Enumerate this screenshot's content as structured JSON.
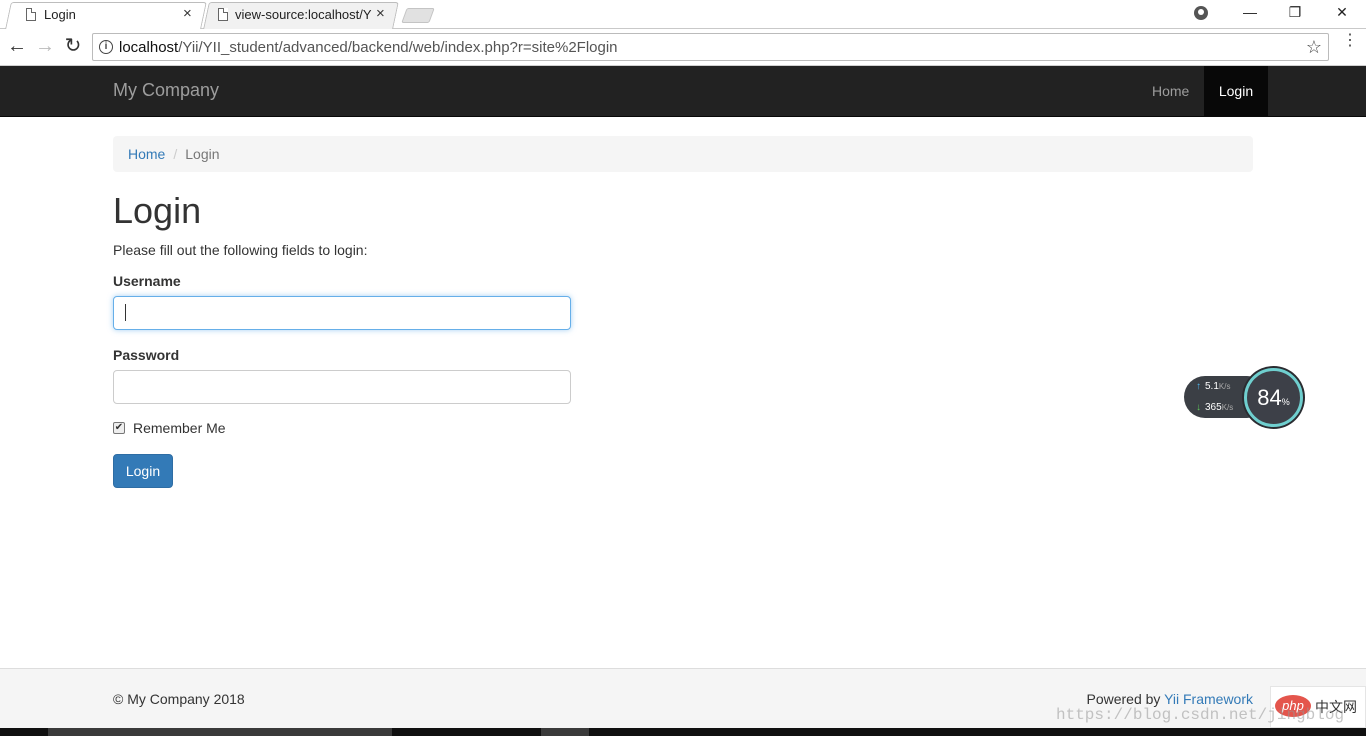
{
  "browser": {
    "tabs": [
      {
        "title": "Login",
        "close": "×"
      },
      {
        "title": "view-source:localhost/Y",
        "close": "×"
      }
    ],
    "window_controls": {
      "minimize": "—",
      "maximize": "❐",
      "close": "✕"
    },
    "nav": {
      "back": "←",
      "forward": "→",
      "reload": "↻"
    },
    "address": {
      "host": "localhost",
      "path": "/Yii/YII_student/advanced/backend/web/index.php?r=site%2Flogin",
      "star": "☆"
    },
    "menu": "⋮"
  },
  "navbar": {
    "brand": "My Company",
    "items": [
      {
        "label": "Home",
        "active": false
      },
      {
        "label": "Login",
        "active": true
      }
    ]
  },
  "breadcrumb": {
    "home": "Home",
    "separator": "/",
    "current": "Login"
  },
  "main": {
    "title": "Login",
    "intro": "Please fill out the following fields to login:",
    "username": {
      "label": "Username",
      "value": ""
    },
    "password": {
      "label": "Password",
      "value": ""
    },
    "remember": {
      "label": "Remember Me",
      "checked": true,
      "mark": "✔"
    },
    "submit": "Login"
  },
  "net_widget": {
    "upload": "5.1",
    "upload_unit": "K/s",
    "download": "365",
    "download_unit": "K/s",
    "percent": "84",
    "percent_sign": "%"
  },
  "footer": {
    "copyright": "© My Company 2018",
    "powered_prefix": "Powered by ",
    "powered_link": "Yii Framework"
  },
  "overlay": {
    "php_logo": "php",
    "php_site": "中文网",
    "watermark": "https://blog.csdn.net/jingblog"
  },
  "colors": {
    "link": "#337ab7",
    "navbar": "#222222",
    "button": "#337ab7"
  }
}
